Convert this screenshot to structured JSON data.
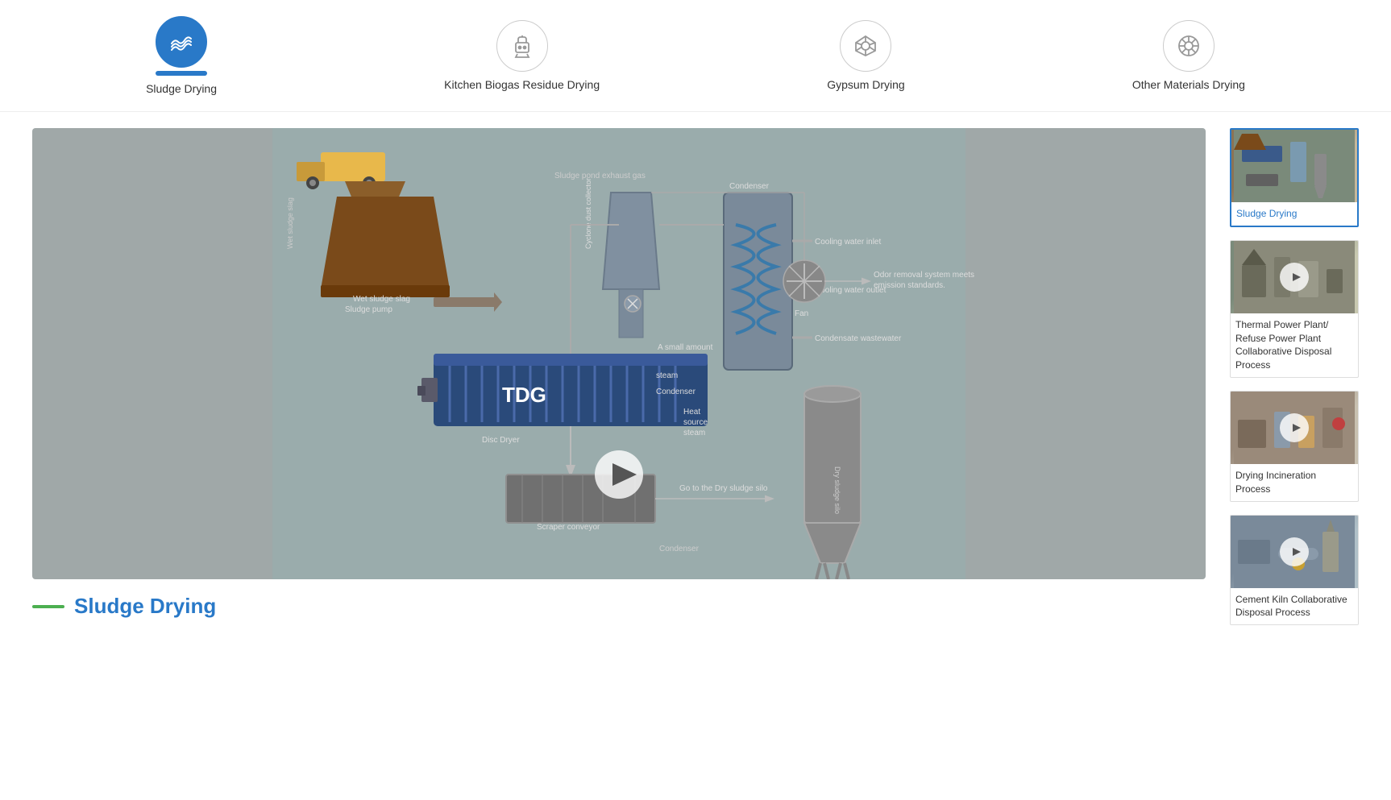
{
  "nav": {
    "items": [
      {
        "id": "sludge-drying",
        "label": "Sludge Drying",
        "active": true
      },
      {
        "id": "kitchen-biogas",
        "label": "Kitchen Biogas Residue Drying",
        "active": false
      },
      {
        "id": "gypsum-drying",
        "label": "Gypsum Drying",
        "active": false
      },
      {
        "id": "other-materials",
        "label": "Other Materials Drying",
        "active": false
      }
    ]
  },
  "diagram": {
    "labels": {
      "sludge_pond": "Sludge pond exhaust gas",
      "wet_sludge": "Wet sludge slag",
      "sludge_pump": "Sludge pump",
      "cyclone_dust": "Cyclone dust collector",
      "a_small_amount": "A small amount",
      "steam": "steam",
      "heat_source": "Heat source steam",
      "condenser_label": "Condenser",
      "disc_dryer": "Disc Dryer",
      "scraper_conveyor": "Scraper conveyor",
      "fan": "Fan",
      "cooling_water_inlet": "Cooling water inlet",
      "cooling_water_outlet": "Cooling water outlet",
      "condensate_wastewater": "Condensate wastewater",
      "odor_removal": "Odor removal system meets emission standards",
      "go_to_dry": "Go to the Dry sludge silo",
      "dry_sludge_silo": "Dry sludge silo",
      "condenser2": "Condenser"
    },
    "title": "Sludge Drying",
    "title_bar_color": "#4caf50"
  },
  "sidebar": {
    "cards": [
      {
        "id": "sludge-drying-card",
        "label": "Sludge Drying",
        "active": true,
        "has_play": false
      },
      {
        "id": "thermal-power-card",
        "label": "Thermal Power Plant/ Refuse Power Plant Collaborative Disposal Process",
        "active": false,
        "has_play": true
      },
      {
        "id": "drying-incineration-card",
        "label": "Drying Incineration Process",
        "active": false,
        "has_play": true
      },
      {
        "id": "cement-kiln-card",
        "label": "Cement Kiln Collaborative Disposal Process",
        "active": false,
        "has_play": true
      }
    ]
  },
  "colors": {
    "primary_blue": "#2979c8",
    "accent_green": "#4caf50",
    "active_border": "#2979c8",
    "diagram_bg": "#9aacac",
    "dryer_blue": "#3a5a8a"
  }
}
